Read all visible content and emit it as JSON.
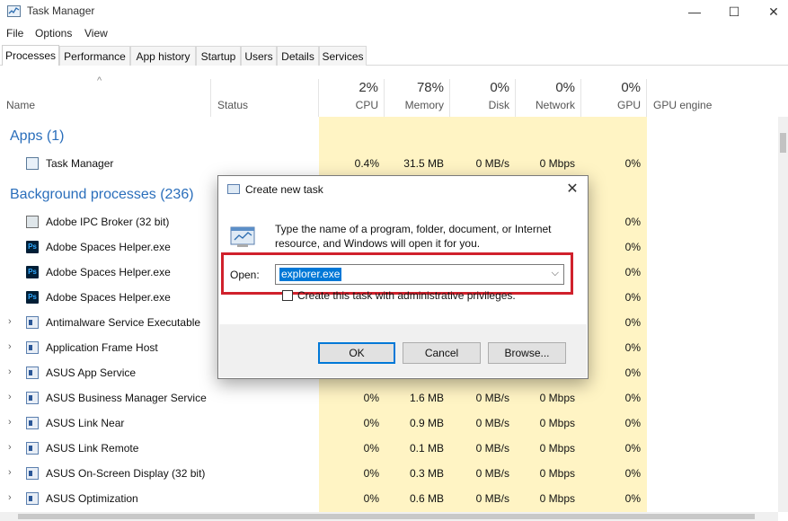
{
  "window": {
    "title": "Task Manager",
    "controls": {
      "minimize": "—",
      "maximize": "☐",
      "close": "✕"
    }
  },
  "menu": [
    "File",
    "Options",
    "View"
  ],
  "tabs": [
    "Processes",
    "Performance",
    "App history",
    "Startup",
    "Users",
    "Details",
    "Services"
  ],
  "active_tab": "Processes",
  "columns": {
    "name": "Name",
    "status": "Status",
    "cpu": {
      "pct": "2%",
      "label": "CPU"
    },
    "memory": {
      "pct": "78%",
      "label": "Memory"
    },
    "disk": {
      "pct": "0%",
      "label": "Disk"
    },
    "network": {
      "pct": "0%",
      "label": "Network"
    },
    "gpu": {
      "pct": "0%",
      "label": "GPU"
    },
    "gpu_engine": "GPU engine"
  },
  "groups": {
    "apps": "Apps (1)",
    "background": "Background processes (236)"
  },
  "app_rows": [
    {
      "name": "Task Manager",
      "cpu": "0.4%",
      "memory": "31.5 MB",
      "disk": "0 MB/s",
      "network": "0 Mbps",
      "gpu": "0%"
    }
  ],
  "bg_rows": [
    {
      "name": "Adobe IPC Broker (32 bit)",
      "cpu": "",
      "memory": "",
      "disk": "",
      "network": "",
      "gpu": "0%"
    },
    {
      "name": "Adobe Spaces Helper.exe",
      "cpu": "",
      "memory": "",
      "disk": "",
      "network": "",
      "gpu": "0%"
    },
    {
      "name": "Adobe Spaces Helper.exe",
      "cpu": "",
      "memory": "",
      "disk": "",
      "network": "",
      "gpu": "0%"
    },
    {
      "name": "Adobe Spaces Helper.exe",
      "cpu": "",
      "memory": "",
      "disk": "",
      "network": "",
      "gpu": "0%"
    },
    {
      "name": "Antimalware Service Executable",
      "cpu": "",
      "memory": "",
      "disk": "",
      "network": "",
      "gpu": "0%"
    },
    {
      "name": "Application Frame Host",
      "cpu": "",
      "memory": "",
      "disk": "",
      "network": "",
      "gpu": "0%"
    },
    {
      "name": "ASUS App Service",
      "cpu": "",
      "memory": "",
      "disk": "",
      "network": "",
      "gpu": "0%"
    },
    {
      "name": "ASUS Business Manager Service",
      "cpu": "0%",
      "memory": "1.6 MB",
      "disk": "0 MB/s",
      "network": "0 Mbps",
      "gpu": "0%"
    },
    {
      "name": "ASUS Link Near",
      "cpu": "0%",
      "memory": "0.9 MB",
      "disk": "0 MB/s",
      "network": "0 Mbps",
      "gpu": "0%"
    },
    {
      "name": "ASUS Link Remote",
      "cpu": "0%",
      "memory": "0.1 MB",
      "disk": "0 MB/s",
      "network": "0 Mbps",
      "gpu": "0%"
    },
    {
      "name": "ASUS On-Screen Display (32 bit)",
      "cpu": "0%",
      "memory": "0.3 MB",
      "disk": "0 MB/s",
      "network": "0 Mbps",
      "gpu": "0%"
    },
    {
      "name": "ASUS Optimization",
      "cpu": "0%",
      "memory": "0.6 MB",
      "disk": "0 MB/s",
      "network": "0 Mbps",
      "gpu": "0%"
    }
  ],
  "dialog": {
    "title": "Create new task",
    "message": "Type the name of a program, folder, document, or Internet resource, and Windows will open it for you.",
    "open_label": "Open:",
    "open_value": "explorer.exe",
    "admin_label": "Create this task with administrative privileges.",
    "ok": "OK",
    "cancel": "Cancel",
    "browse": "Browse...",
    "close": "✕"
  },
  "colors": {
    "highlight_col": "#fff4c4",
    "group_title": "#2a6ebb",
    "accent": "#0078d7",
    "annotation_red": "#d0212c"
  }
}
